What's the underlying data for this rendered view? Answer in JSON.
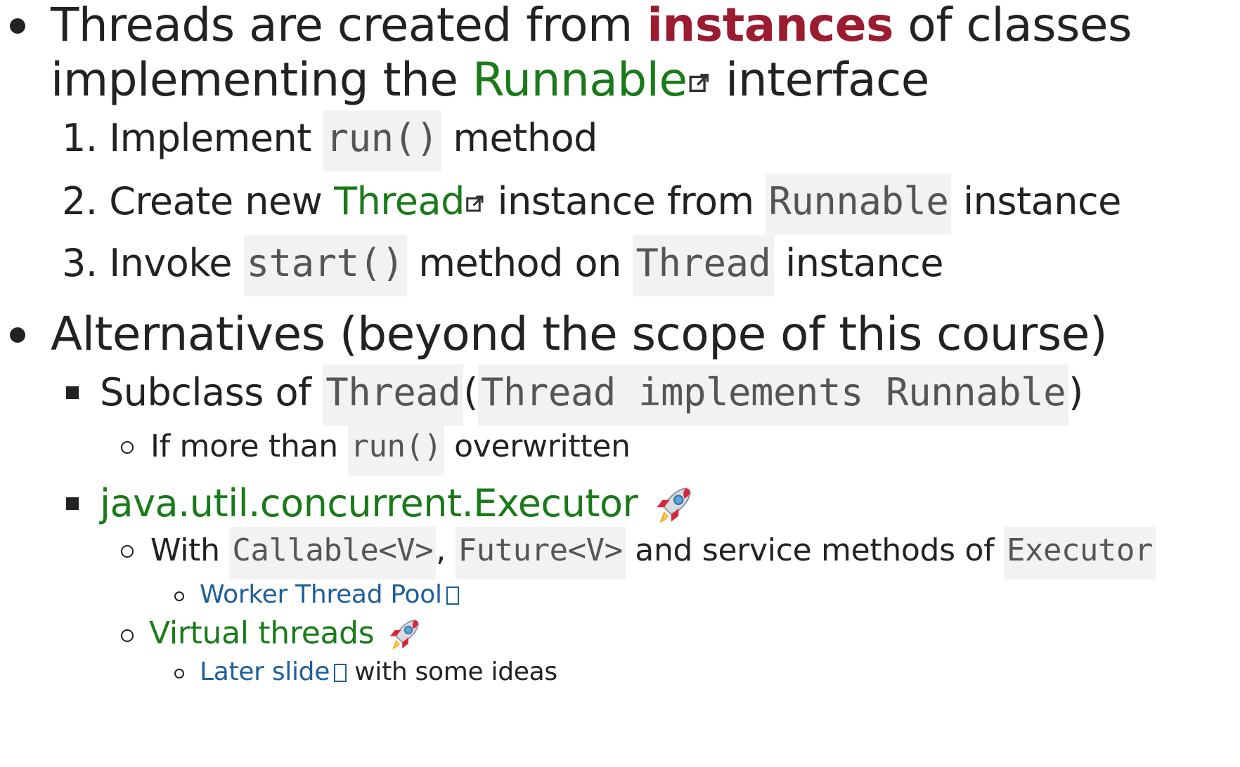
{
  "bullet1": {
    "line1_pre": "Threads are created from ",
    "line1_emph": "instances",
    "line1_post": " of classes",
    "line2_pre": "implementing the ",
    "line2_link": "Runnable",
    "line2_post": " interface"
  },
  "steps": [
    {
      "num": "1.",
      "pre": "Implement ",
      "code": "run()",
      "post": " method"
    },
    {
      "num": "2.",
      "pre": "Create new ",
      "link": "Thread",
      "mid": " instance from ",
      "code": "Runnable",
      "post": " instance"
    },
    {
      "num": "3.",
      "pre": "Invoke ",
      "code": "start()",
      "mid": " method on ",
      "code2": "Thread",
      "post": " instance"
    }
  ],
  "bullet2": {
    "title": "Alternatives (beyond the scope of this course)",
    "sub1": {
      "pre": "Subclass of ",
      "code": "Thread",
      "paren_open": "(",
      "code2": "Thread implements Runnable",
      "paren_close": ")"
    },
    "sub1_note": {
      "pre": "If more than ",
      "code": "run()",
      "post": " overwritten"
    },
    "sub2": {
      "link": "java.util.concurrent.Executor"
    },
    "sub2_note": {
      "pre": "With ",
      "code": "Callable<V>",
      "sep": ", ",
      "code2": "Future<V>",
      "mid": " and service methods of ",
      "code3": "Executor"
    },
    "sub2_link": "Worker Thread Pool",
    "virtual": "Virtual threads",
    "later_link": "Later slide",
    "later_post": " with some ideas"
  },
  "icons": {
    "external": "external-link-icon",
    "rocket": "rocket-icon"
  },
  "colors": {
    "emphasis": "#9b1b30",
    "green_link": "#1a7a1a",
    "blue_link": "#1f5f9a",
    "code_bg": "#f2f2f2"
  }
}
